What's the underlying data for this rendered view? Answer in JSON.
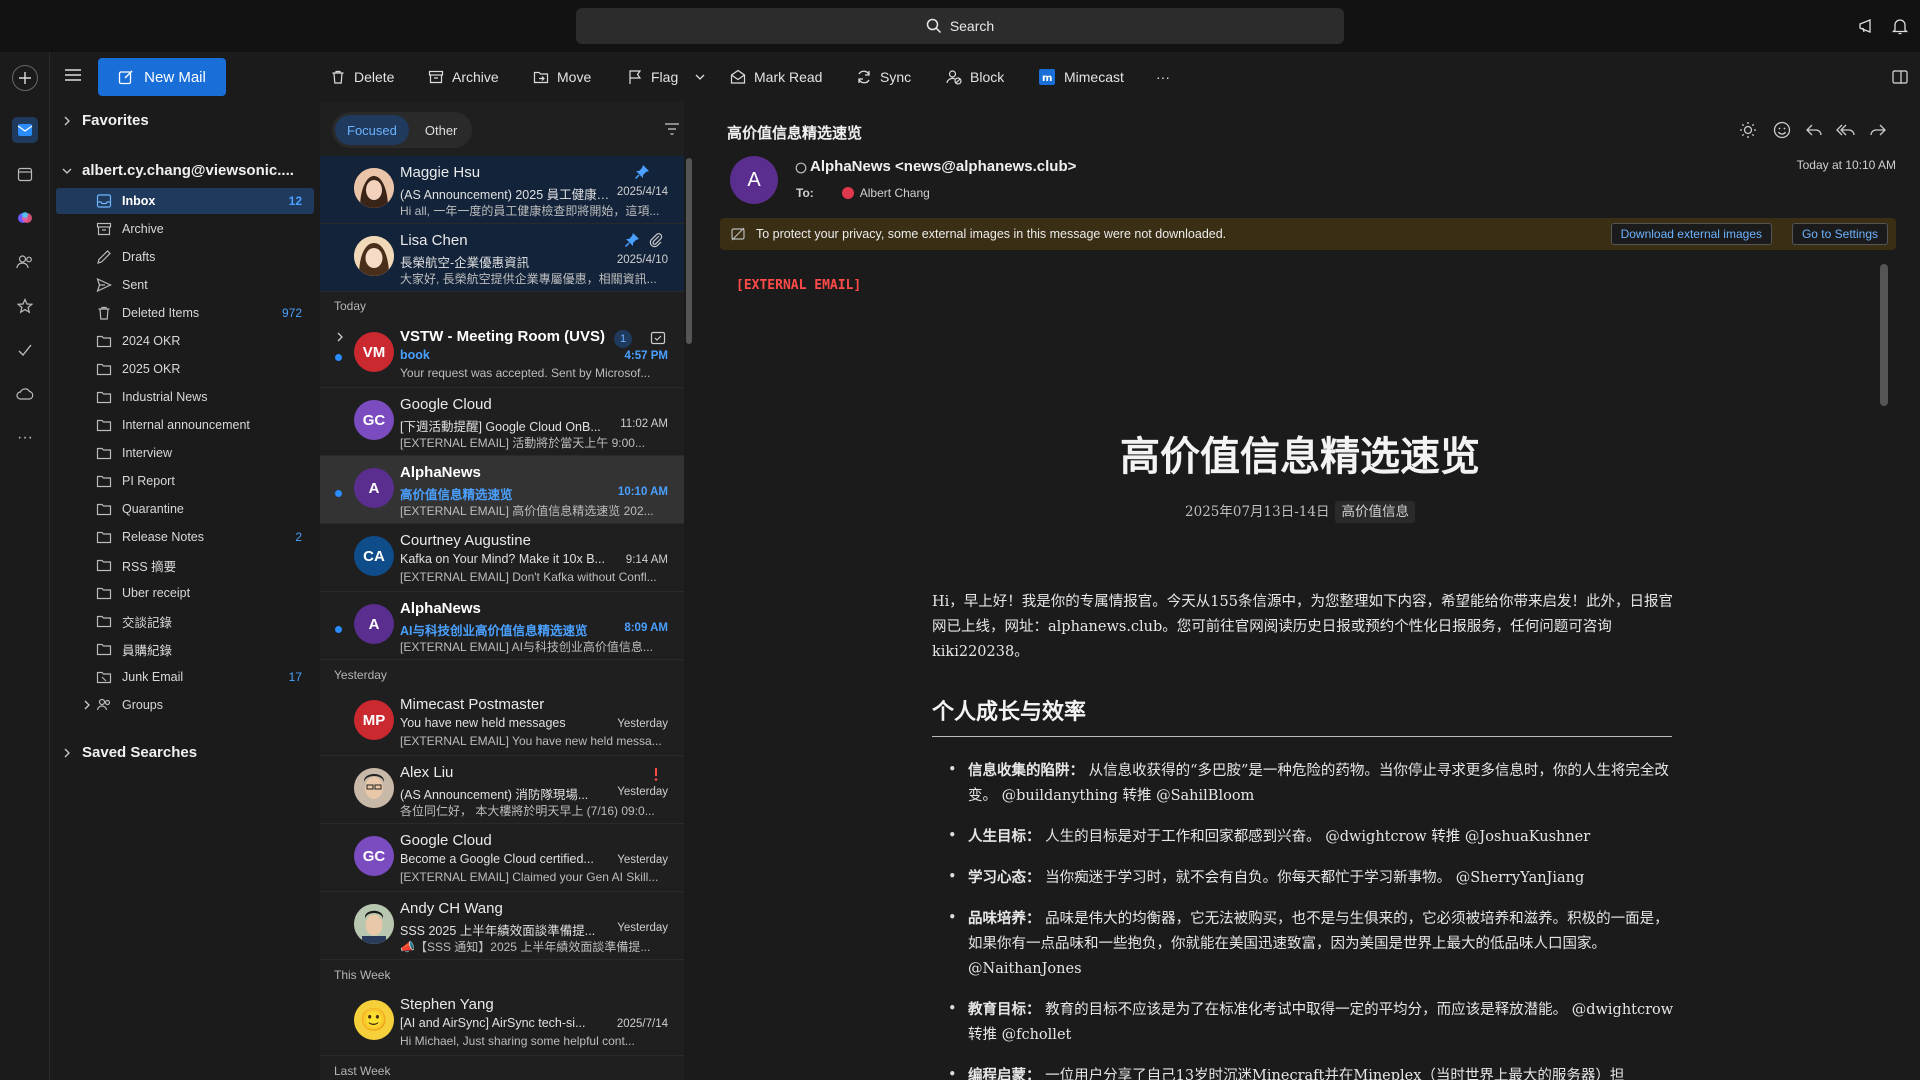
{
  "topbar": {
    "search_label": "Search"
  },
  "toolbar": {
    "new_mail": "New Mail",
    "delete": "Delete",
    "archive": "Archive",
    "move": "Move",
    "flag": "Flag",
    "mark_read": "Mark Read",
    "sync": "Sync",
    "block": "Block",
    "mimecast": "Mimecast",
    "more": "···"
  },
  "folders": {
    "favorites": "Favorites",
    "account": "albert.cy.chang@viewsonic....",
    "saved_searches": "Saved Searches",
    "items": [
      {
        "label": "Inbox",
        "count": "12"
      },
      {
        "label": "Archive",
        "count": ""
      },
      {
        "label": "Drafts",
        "count": ""
      },
      {
        "label": "Sent",
        "count": ""
      },
      {
        "label": "Deleted Items",
        "count": "972"
      },
      {
        "label": "2024 OKR",
        "count": ""
      },
      {
        "label": "2025 OKR",
        "count": ""
      },
      {
        "label": "Industrial News",
        "count": ""
      },
      {
        "label": "Internal announcement",
        "count": ""
      },
      {
        "label": "Interview",
        "count": ""
      },
      {
        "label": "PI Report",
        "count": ""
      },
      {
        "label": "Quarantine",
        "count": ""
      },
      {
        "label": "Release Notes",
        "count": "2"
      },
      {
        "label": "RSS 摘要",
        "count": ""
      },
      {
        "label": "Uber receipt",
        "count": ""
      },
      {
        "label": "交談記錄",
        "count": ""
      },
      {
        "label": "員購紀錄",
        "count": ""
      },
      {
        "label": "Junk Email",
        "count": "17"
      },
      {
        "label": "Groups",
        "count": ""
      }
    ]
  },
  "list": {
    "tabs": [
      "Focused",
      "Other"
    ],
    "groups": {
      "today": "Today",
      "yesterday": "Yesterday",
      "this_week": "This Week",
      "last_week": "Last Week"
    },
    "messages": [
      {
        "sender": "Maggie Hsu",
        "subject": "(AS Announcement) 2025 員工健康檢查...",
        "preview": "Hi all, 一年一度的員工健康檢查即將開始，這項...",
        "time": "2025/4/14"
      },
      {
        "sender": "Lisa Chen",
        "subject": "長榮航空-企業優惠資訊",
        "preview": "大家好, 長榮航空提供企業專屬優惠，相關資訊...",
        "time": "2025/4/10"
      },
      {
        "sender": "VSTW - Meeting Room (UVS)",
        "badge": "1",
        "subject": "book",
        "preview": "Your request was accepted. Sent by Microsof...",
        "time": "4:57 PM",
        "initials": "VM"
      },
      {
        "sender": "Google Cloud",
        "subject": "[下週活動提醒] Google Cloud OnB...",
        "preview": "[EXTERNAL EMAIL] 活動將於當天上午 9:00...",
        "time": "11:02 AM",
        "initials": "GC"
      },
      {
        "sender": "AlphaNews",
        "subject": "高价值信息精选速览",
        "preview": "[EXTERNAL EMAIL] 高价值信息精选速览 202...",
        "time": "10:10 AM",
        "initials": "A"
      },
      {
        "sender": "Courtney Augustine",
        "subject": "Kafka on Your Mind? Make it 10x B...",
        "preview": "[EXTERNAL EMAIL] Don't Kafka without Confl...",
        "time": "9:14 AM",
        "initials": "CA"
      },
      {
        "sender": "AlphaNews",
        "subject": "AI与科技创业高价值信息精选速览",
        "preview": "[EXTERNAL EMAIL] AI与科技创业高价值信息...",
        "time": "8:09 AM",
        "initials": "A"
      },
      {
        "sender": "Mimecast Postmaster",
        "subject": "You have new held messages",
        "preview": "[EXTERNAL EMAIL] You have new held messa...",
        "time": "Yesterday",
        "initials": "MP"
      },
      {
        "sender": "Alex Liu",
        "subject": "(AS Announcement) 消防隊現場...",
        "preview": "各位同仁好， 本大樓將於明天早上 (7/16) 09:0...",
        "time": "Yesterday"
      },
      {
        "sender": "Google Cloud",
        "subject": "Become a Google Cloud certified...",
        "preview": "[EXTERNAL EMAIL] Claimed your Gen AI Skill...",
        "time": "Yesterday",
        "initials": "GC"
      },
      {
        "sender": "Andy CH Wang",
        "subject": "SSS 2025 上半年績效面談準備提...",
        "preview": "📣【SSS 通知】2025 上半年績效面談準備提...",
        "time": "Yesterday"
      },
      {
        "sender": "Stephen Yang",
        "subject": "[AI and AirSync] AirSync tech-si...",
        "preview": "Hi Michael, Just sharing some helpful cont...",
        "time": "2025/7/14",
        "emoji": "🙂"
      }
    ]
  },
  "reading": {
    "subject": "高价值信息精选速览",
    "avatar": "A",
    "from": "AlphaNews <news@alphanews.club>",
    "to_label": "To:",
    "to_name": "Albert Chang",
    "date": "Today at 10:10 AM",
    "privacy": "To protect your privacy, some external images in this message were not downloaded.",
    "download_btn": "Download external images",
    "settings_btn": "Go to Settings",
    "ext_tag": "[EXTERNAL EMAIL]",
    "title": "高价值信息精选速览",
    "date_line": "2025年07月13日-14日",
    "date_tag": "高价值信息",
    "intro": "Hi，早上好！我是你的专属情报官。今天从155条信源中，为您整理如下内容，希望能给你带来启发！此外，日报官网已上线，网址：alphanews.club。您可前往官网阅读历史日报或预约个性化日报服务，任何问题可咨询kiki220238。",
    "section": "个人成长与效率",
    "bullets": [
      {
        "head": "信息收集的陷阱：",
        "body": "从信息收获得的“多巴胺”是一种危险的药物。当你停止寻求更多信息时，你的人生将完全改变。 @buildanything 转推 @SahilBloom"
      },
      {
        "head": "人生目标：",
        "body": "人生的目标是对于工作和回家都感到兴奋。 @dwightcrow 转推 @JoshuaKushner"
      },
      {
        "head": "学习心态：",
        "body": "当你痴迷于学习时，就不会有自负。你每天都忙于学习新事物。 @SherryYanJiang"
      },
      {
        "head": "品味培养：",
        "body": "品味是伟大的均衡器，它无法被购买，也不是与生俱来的，它必须被培养和滋养。积极的一面是，如果你有一点品味和一些抱负，你就能在美国迅速致富，因为美国是世界上最大的低品味人口国家。 @NaithanJones"
      },
      {
        "head": "教育目标：",
        "body": "教育的目标不应该是为了在标准化考试中取得一定的平均分，而应该是释放潜能。 @dwightcrow 转推 @fchollet"
      },
      {
        "head": "编程启蒙：",
        "body": "一位用户分享了自己13岁时沉迷Minecraft并在Mineplex（当时世界上最大的服务器）担"
      }
    ]
  }
}
